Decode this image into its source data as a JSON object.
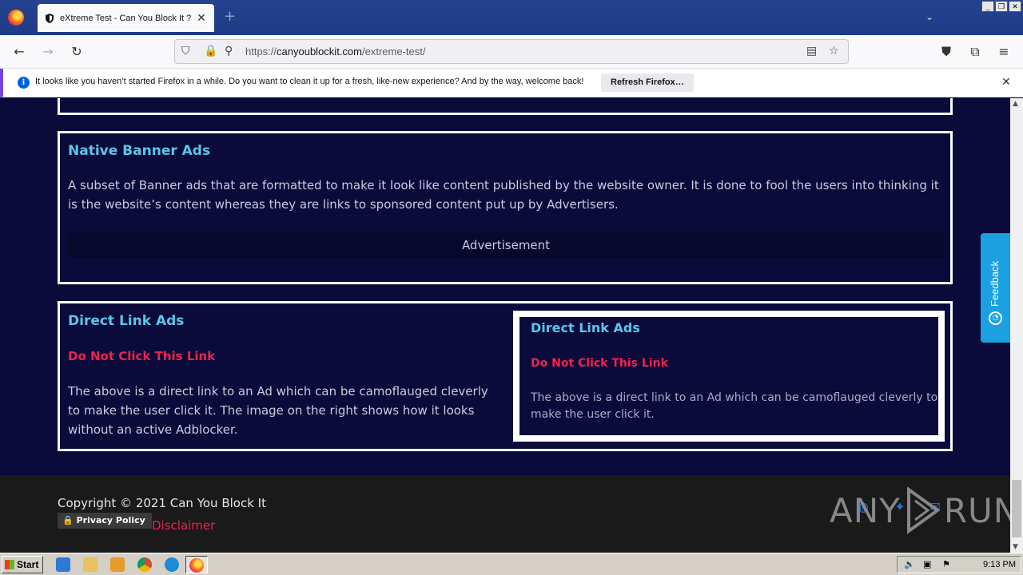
{
  "browser": {
    "tab_title": "eXtreme Test - Can You Block It ?",
    "url_prefix": "https://",
    "url_host": "canyoublockit.com",
    "url_path": "/extreme-test/",
    "notification_message": "It looks like you haven’t started Firefox in a while. Do you want to clean it up for a fresh, like-new experience? And by the way, welcome back!",
    "notification_button": "Refresh Firefox…"
  },
  "page": {
    "native_banner": {
      "title": "Native Banner Ads",
      "description": "A subset of Banner ads that are formatted to make it look like content published by the website owner. It is done to fool the users into thinking it is the website’s content whereas they are links to sponsored content put up by Advertisers.",
      "ad_label": "Advertisement"
    },
    "direct_link": {
      "title": "Direct Link Ads",
      "link_text": "Do Not Click This Link",
      "description": "The above is a direct link to an Ad which can be camoflauged cleverly to make the user click it. The image on the right shows how it looks without an active Adblocker."
    },
    "preview": {
      "title": "Direct Link Ads",
      "link_text": "Do Not Click This Link",
      "description": "The above is a direct link to an Ad which can be camoflauged cleverly to make the user click it."
    },
    "footer": {
      "copyright": "Copyright © 2021 Can You Block It",
      "privacy_policy": "Privacy Policy",
      "disclaimer": "Disclaimer"
    },
    "feedback_label": "Feedback",
    "watermark_left": "ANY",
    "watermark_right": "RUN"
  },
  "taskbar": {
    "start_label": "Start",
    "clock": "9:13 PM"
  },
  "colors": {
    "page_bg": "#0a0b3a",
    "heading": "#5bc6e8",
    "link_red": "#f0224f",
    "feedback": "#1ba1e2"
  },
  "icons": [
    "firefox-icon",
    "shield-icon",
    "back-icon",
    "forward-icon",
    "reload-icon",
    "lock-icon",
    "reader-icon",
    "star-icon",
    "pocket-icon",
    "extensions-icon",
    "menu-icon",
    "info-icon",
    "close-icon"
  ]
}
